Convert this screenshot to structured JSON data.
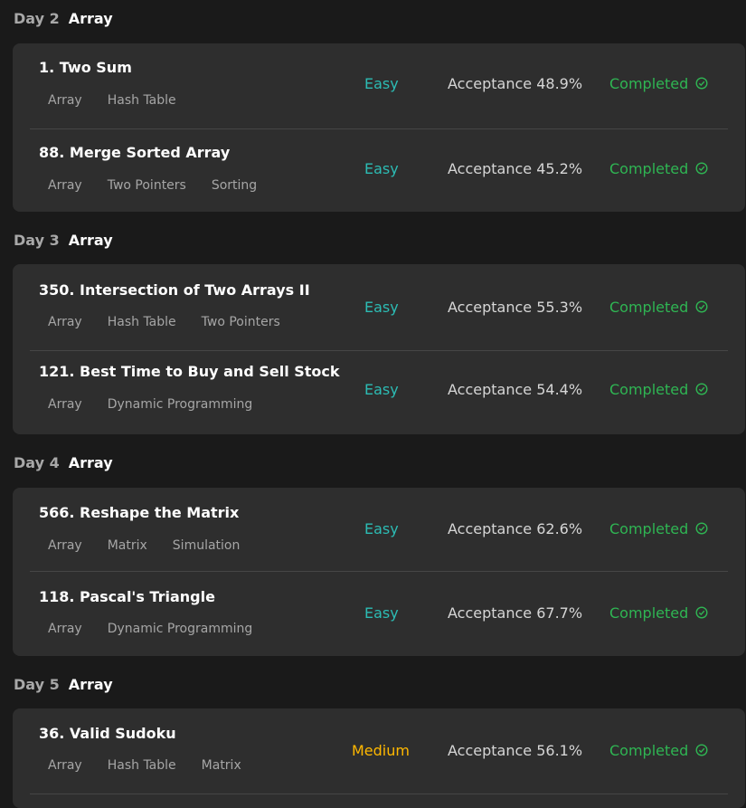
{
  "colors": {
    "background": "#1a1a1a",
    "card": "#2e2e2e",
    "easy": "#2cbcb4",
    "medium": "#ffb800",
    "completed": "#2fb553"
  },
  "days": [
    {
      "label": "Day 2",
      "topic": "Array",
      "problems": [
        {
          "title": "1. Two Sum",
          "tags": [
            "Array",
            "Hash Table"
          ],
          "difficulty": "Easy",
          "acceptance": "Acceptance 48.9%",
          "status": "Completed",
          "status_icon": "check-circle-icon"
        },
        {
          "title": "88. Merge Sorted Array",
          "tags": [
            "Array",
            "Two Pointers",
            "Sorting"
          ],
          "difficulty": "Easy",
          "acceptance": "Acceptance 45.2%",
          "status": "Completed",
          "status_icon": "check-circle-icon"
        }
      ]
    },
    {
      "label": "Day 3",
      "topic": "Array",
      "problems": [
        {
          "title": "350. Intersection of Two Arrays II",
          "tags": [
            "Array",
            "Hash Table",
            "Two Pointers"
          ],
          "difficulty": "Easy",
          "acceptance": "Acceptance 55.3%",
          "status": "Completed",
          "status_icon": "check-circle-icon"
        },
        {
          "title": "121. Best Time to Buy and Sell Stock",
          "tags": [
            "Array",
            "Dynamic Programming"
          ],
          "difficulty": "Easy",
          "acceptance": "Acceptance 54.4%",
          "status": "Completed",
          "status_icon": "check-circle-icon"
        }
      ]
    },
    {
      "label": "Day 4",
      "topic": "Array",
      "problems": [
        {
          "title": "566. Reshape the Matrix",
          "tags": [
            "Array",
            "Matrix",
            "Simulation"
          ],
          "difficulty": "Easy",
          "acceptance": "Acceptance 62.6%",
          "status": "Completed",
          "status_icon": "check-circle-icon"
        },
        {
          "title": "118. Pascal's Triangle",
          "tags": [
            "Array",
            "Dynamic Programming"
          ],
          "difficulty": "Easy",
          "acceptance": "Acceptance 67.7%",
          "status": "Completed",
          "status_icon": "check-circle-icon"
        }
      ]
    },
    {
      "label": "Day 5",
      "topic": "Array",
      "problems": [
        {
          "title": "36. Valid Sudoku",
          "tags": [
            "Array",
            "Hash Table",
            "Matrix"
          ],
          "difficulty": "Medium",
          "acceptance": "Acceptance 56.1%",
          "status": "Completed",
          "status_icon": "check-circle-icon"
        }
      ]
    }
  ]
}
